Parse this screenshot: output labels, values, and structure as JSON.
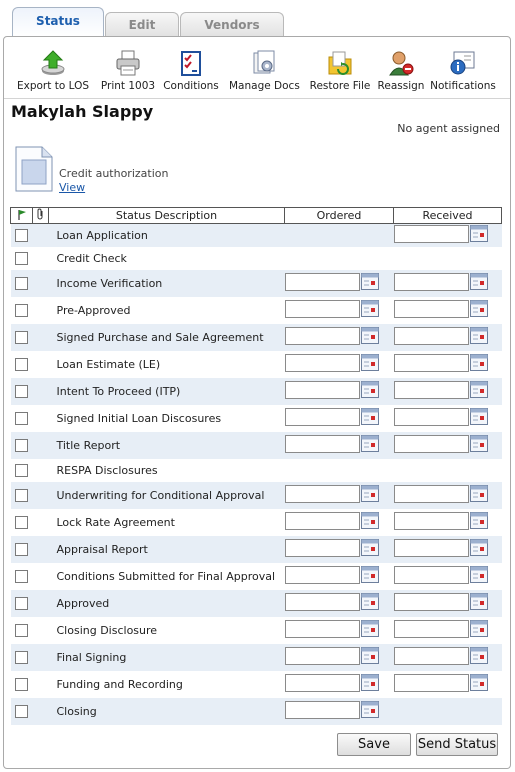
{
  "tabs": [
    "Status",
    "Edit",
    "Vendors"
  ],
  "toolbar": {
    "export": "Export to LOS",
    "print": "Print 1003",
    "conditions": "Conditions",
    "manage_docs": "Manage Docs",
    "restore": "Restore File",
    "reassign": "Reassign",
    "notifications": "Notifications"
  },
  "borrower_name": "Makylah Slappy",
  "agent_status": "No agent assigned",
  "document": {
    "title": "Credit authorization",
    "view_link": "View"
  },
  "table": {
    "headers": {
      "description": "Status Description",
      "ordered": "Ordered",
      "received": "Received"
    },
    "rows": [
      {
        "label": "Loan Application",
        "ordered": false,
        "received": true
      },
      {
        "label": "Credit Check",
        "ordered": false,
        "received": false
      },
      {
        "label": "Income Verification",
        "ordered": true,
        "received": true
      },
      {
        "label": "Pre-Approved",
        "ordered": true,
        "received": true
      },
      {
        "label": "Signed Purchase and Sale Agreement",
        "ordered": true,
        "received": true
      },
      {
        "label": "Loan Estimate (LE)",
        "ordered": true,
        "received": true
      },
      {
        "label": "Intent To Proceed (ITP)",
        "ordered": true,
        "received": true
      },
      {
        "label": "Signed Initial Loan Discosures",
        "ordered": true,
        "received": true
      },
      {
        "label": "Title Report",
        "ordered": true,
        "received": true
      },
      {
        "label": "RESPA Disclosures",
        "ordered": false,
        "received": false
      },
      {
        "label": "Underwriting for Conditional Approval",
        "ordered": true,
        "received": true
      },
      {
        "label": "Lock Rate Agreement",
        "ordered": true,
        "received": true
      },
      {
        "label": "Appraisal Report",
        "ordered": true,
        "received": true
      },
      {
        "label": "Conditions Submitted for Final Approval",
        "ordered": true,
        "received": true
      },
      {
        "label": "Approved",
        "ordered": true,
        "received": true
      },
      {
        "label": "Closing Disclosure",
        "ordered": true,
        "received": true
      },
      {
        "label": "Final Signing",
        "ordered": true,
        "received": true
      },
      {
        "label": "Funding and Recording",
        "ordered": true,
        "received": true
      },
      {
        "label": "Closing",
        "ordered": true,
        "received": false
      }
    ]
  },
  "buttons": {
    "save": "Save",
    "send_status": "Send Status"
  },
  "colors": {
    "tab_active_text": "#1e5fae",
    "row_shade": "#e7eef6",
    "link": "#1a57a8"
  }
}
